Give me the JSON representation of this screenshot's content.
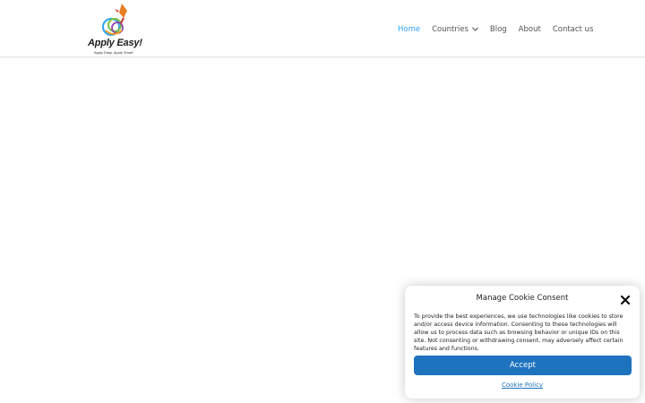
{
  "site": {
    "logo_title": "Apply Easy!",
    "logo_tagline": "Apply Easy, Apply Smart"
  },
  "nav": {
    "items": [
      {
        "label": "Home",
        "active": true
      },
      {
        "label": "Countries",
        "has_dropdown": true
      },
      {
        "label": "Blog"
      },
      {
        "label": "About"
      },
      {
        "label": "Contact us"
      }
    ],
    "active_color": "#2ea3f2"
  },
  "consent": {
    "title": "Manage Cookie Consent",
    "body": "To provide the best experiences, we use technologies like cookies to store and/or access device information. Consenting to these technologies will allow us to process data such as browsing behavior or unique IDs on this site. Not consenting or withdrawing consent, may adversely affect certain features and functions.",
    "accept_label": "Accept",
    "policy_label": "Cookie Policy",
    "accent_color": "#1e73be"
  },
  "icons": {
    "close": "close-icon",
    "dropdown": "chevron-down-icon",
    "logo": "rocket-swirl-logo"
  }
}
